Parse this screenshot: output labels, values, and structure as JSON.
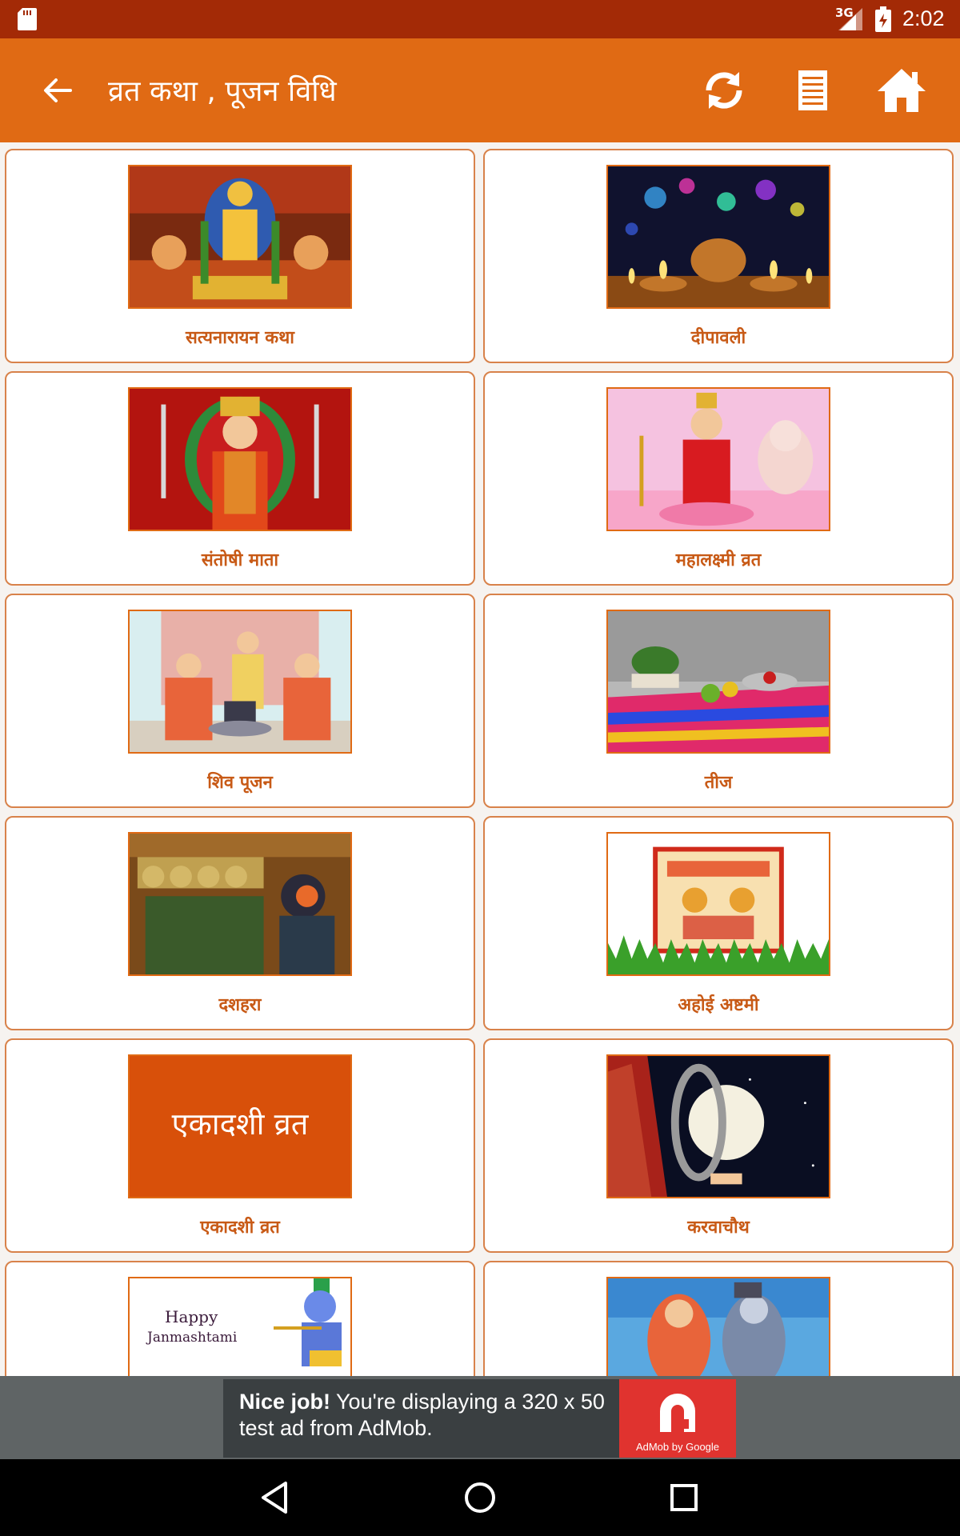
{
  "status_bar": {
    "network": "3G",
    "time": "2:02"
  },
  "toolbar": {
    "title": "व्रत कथा , पूजन विधि"
  },
  "items": [
    {
      "label": "सत्यनारायन कथा"
    },
    {
      "label": "दीपावली"
    },
    {
      "label": "संतोषी माता"
    },
    {
      "label": "महालक्ष्मी व्रत"
    },
    {
      "label": "शिव पूजन"
    },
    {
      "label": "तीज"
    },
    {
      "label": "दशहरा"
    },
    {
      "label": "अहोई अष्टमी"
    },
    {
      "label": "एकादशी व्रत",
      "thumb_text": "एकादशी व्रत"
    },
    {
      "label": "करवाचौथ"
    },
    {
      "label": "",
      "thumb_text_line1": "Happy",
      "thumb_text_line2": "Janmashtami"
    },
    {
      "label": ""
    }
  ],
  "ad": {
    "headline": "Nice job!",
    "body": " You're displaying a 320 x 50 test ad from AdMob.",
    "logo_label": "AdMob by Google"
  },
  "colors": {
    "status_bar": "#a32a06",
    "toolbar": "#e06a14",
    "card_border": "#d8824a",
    "label": "#c85a16"
  }
}
